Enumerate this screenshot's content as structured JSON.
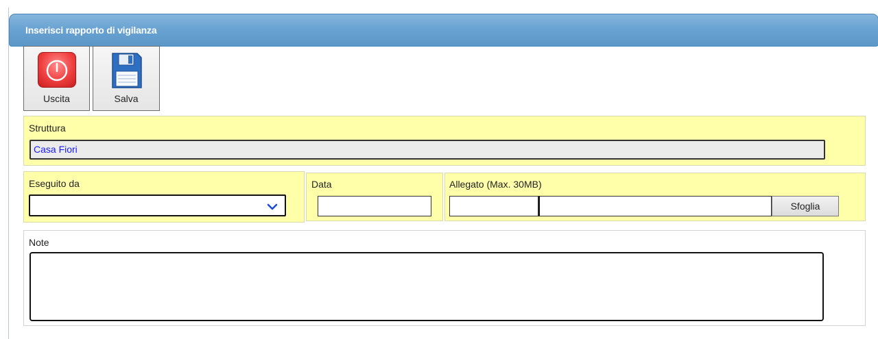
{
  "header": {
    "title": "Inserisci rapporto di vigilanza"
  },
  "toolbar": {
    "exit_label": "Uscita",
    "save_label": "Salva"
  },
  "form": {
    "struttura": {
      "label": "Struttura",
      "value": "Casa Fiori"
    },
    "eseguito_da": {
      "label": "Eseguito da",
      "value": ""
    },
    "data": {
      "label": "Data",
      "value": ""
    },
    "allegato": {
      "label": "Allegato (Max. 30MB)",
      "browse_label": "Sfoglia"
    },
    "note": {
      "label": "Note",
      "value": ""
    }
  },
  "colors": {
    "header": "#6aa3d2",
    "field_background": "#ffffaa",
    "value_text": "#1a1aff",
    "exit_icon": "#ef3f3f",
    "save_icon": "#2f6fc2"
  },
  "icons": {
    "exit": "power-icon",
    "save": "floppy-disk-icon",
    "dropdown": "chevron-down-icon"
  }
}
